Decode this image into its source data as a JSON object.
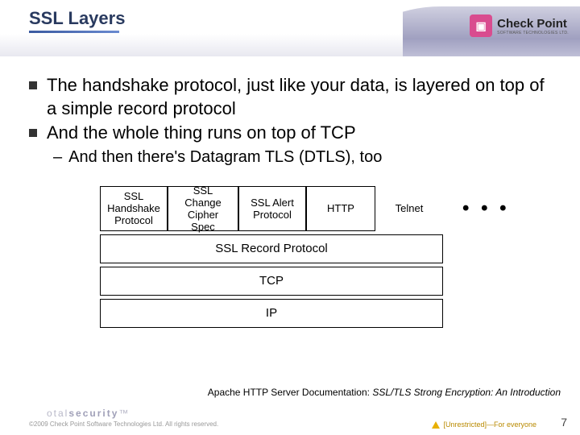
{
  "header": {
    "title": "SSL Layers",
    "logo": {
      "name": "Check Point",
      "sub": "SOFTWARE TECHNOLOGIES LTD."
    }
  },
  "bullets": [
    "The handshake protocol, just like your data, is layered on top of a simple record protocol",
    "And the whole thing runs on top of TCP"
  ],
  "sub_bullet": "And then there's Datagram TLS (DTLS), too",
  "diagram": {
    "top": [
      "SSL Handshake Protocol",
      "SSL Change Cipher Spec",
      "SSL Alert Protocol",
      "HTTP",
      "Telnet"
    ],
    "ellipsis": "• • •",
    "layers": [
      "SSL Record Protocol",
      "TCP",
      "IP"
    ]
  },
  "citation": {
    "prefix": "Apache HTTP Server Documentation: ",
    "title": "SSL/TLS Strong Encryption: An Introduction"
  },
  "footer": {
    "tag_light": "otal",
    "tag_bold": "security",
    "copyright": "©2009 Check Point Software Technologies Ltd. All rights reserved.",
    "classification": "[Unrestricted]—For everyone",
    "page": "7"
  }
}
